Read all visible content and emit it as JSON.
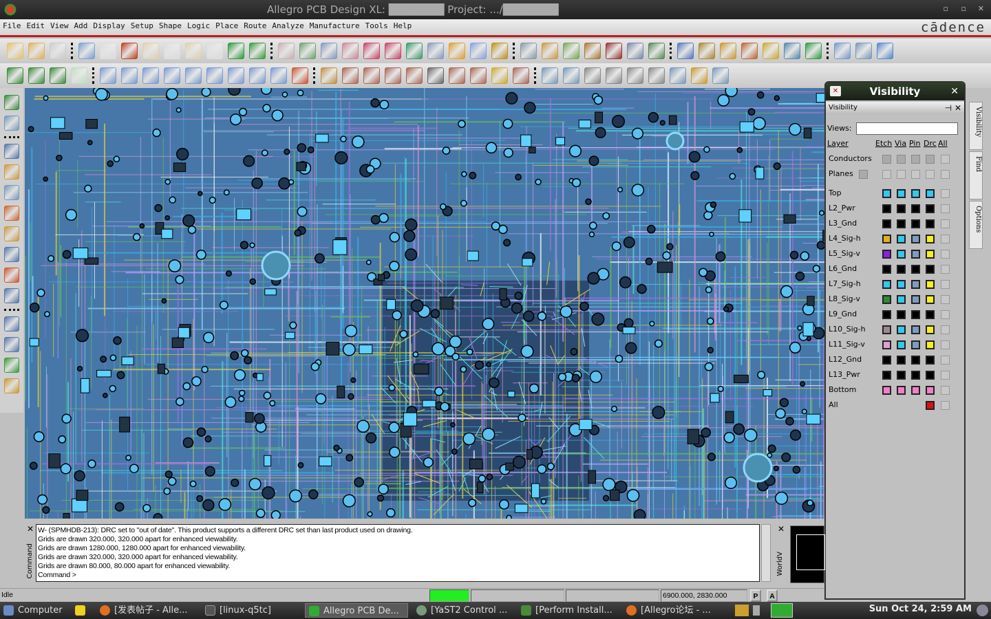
{
  "window": {
    "title": "Allegro PCB Design XL: ███████ Project: .../███████",
    "minimize": "▫",
    "maximize": "▫",
    "close": "✕"
  },
  "menu": {
    "items": [
      "File",
      "Edit",
      "View",
      "Add",
      "Display",
      "Setup",
      "Shape",
      "Logic",
      "Place",
      "Route",
      "Analyze",
      "Manufacture",
      "Tools",
      "Help"
    ],
    "brand": "cādence"
  },
  "toolbar1": [
    [
      "new-file-icon",
      "#e8c070"
    ],
    [
      "open-folder-icon",
      "#e0b060"
    ],
    [
      "save-icon",
      "#ccc"
    ],
    "|",
    [
      "move-icon",
      "#7aa0d0"
    ],
    [
      "copy-icon",
      "#ddd"
    ],
    [
      "delete-icon",
      "#c04020"
    ],
    [
      "undo-icon",
      "#e0d0b0"
    ],
    [
      "undo-list-icon",
      "#ddd"
    ],
    [
      "redo-icon",
      "#e0d0b0"
    ],
    [
      "redo-list-icon",
      "#ddd"
    ],
    [
      "done-icon",
      "#2a9a3a"
    ],
    [
      "pin-icon",
      "#3a9a3a"
    ],
    "|",
    [
      "grid-icon",
      "#c8b0b0"
    ],
    [
      "ratsnest-icon",
      "#70a070"
    ],
    [
      "zoom-fit-icon",
      "#8899bb"
    ],
    [
      "zoom-in-window-icon",
      "#cc8899"
    ],
    [
      "zoom-in-icon",
      "#cc4466"
    ],
    [
      "zoom-out-icon",
      "#cc4466"
    ],
    [
      "zoom-previous-icon",
      "#3a9a6a"
    ],
    [
      "zoom-world-icon",
      "#8899bb"
    ],
    [
      "redraw-icon",
      "#e0a030"
    ],
    [
      "3d-view-icon",
      "#8aa0dd"
    ],
    [
      "flip-icon",
      "#c09020"
    ],
    "|",
    [
      "grid-toggle-icon",
      "#8899aa"
    ],
    [
      "color-icon",
      "#cc9944"
    ],
    [
      "layers-icon",
      "#77aa55"
    ],
    [
      "shadow-icon",
      "#aa7733"
    ],
    [
      "stats-icon",
      "#993333"
    ],
    [
      "spreadsheet-icon",
      "#7788aa"
    ],
    [
      "board-icon",
      "#558855"
    ],
    "|",
    [
      "info-icon",
      "#5577bb"
    ],
    [
      "property-icon",
      "#aa8833"
    ],
    [
      "number-icon",
      "#cc9933"
    ],
    [
      "dehighlight-icon",
      "#bb6633"
    ],
    [
      "highlight-icon",
      "#ccaa33"
    ],
    [
      "bars-icon",
      "#5588aa"
    ],
    [
      "filter-icon",
      "#339944"
    ],
    "|",
    [
      "windows-icon",
      "#7799cc"
    ],
    [
      "mail-icon",
      "#7799bb"
    ],
    [
      "help-icon",
      "#5588cc"
    ]
  ],
  "toolbar2": [
    [
      "add-connect-icon",
      "#3a8a3a"
    ],
    [
      "slide-icon",
      "#3a8a3a"
    ],
    [
      "via-icon",
      "#3a8a3a"
    ],
    [
      "copper-icon",
      "#bde0bd"
    ],
    "|",
    [
      "shape-polygon-icon",
      "#7a9ad0"
    ],
    [
      "shape-rect-icon",
      "#7a9ad0"
    ],
    [
      "shape-circle-icon",
      "#7a9ad0"
    ],
    [
      "shape-select-icon",
      "#7a9ad0"
    ],
    [
      "shape-merge-icon",
      "#7a9ad0"
    ],
    [
      "shape-void-icon",
      "#7a9ad0"
    ],
    [
      "shape-void-rect-icon",
      "#7a9ad0"
    ],
    [
      "shape-void-circle-icon",
      "#7a9ad0"
    ],
    [
      "shape-edit-icon",
      "#7a9ad0"
    ],
    [
      "shape-delete-icon",
      "#cc5533"
    ],
    "|",
    [
      "dimension-icon",
      "#c09040"
    ],
    [
      "dim-linear-icon",
      "#aa6655"
    ],
    [
      "dim-length-icon",
      "#aa6655"
    ],
    [
      "dim-pin-icon",
      "#aa6655"
    ],
    [
      "dim-angle-icon",
      "#aa6655"
    ],
    [
      "line-icon",
      "#666"
    ],
    [
      "measure-icon",
      "#aa6655"
    ],
    [
      "cut-icon",
      "#aa6655"
    ],
    [
      "coin-icon",
      "#ccaa33"
    ],
    [
      "angle-icon",
      "#aa6655"
    ],
    "|",
    [
      "edit-text-icon",
      "#7799bb"
    ],
    [
      "mirror-icon",
      "#7799bb"
    ],
    [
      "rotate-icon",
      "#888"
    ],
    [
      "camera-icon",
      "#888"
    ],
    [
      "ref-des-icon",
      "#888"
    ],
    [
      "flag-icon",
      "#888"
    ],
    [
      "scan-icon",
      "#7799bb"
    ],
    [
      "key-icon",
      "#cc9933"
    ],
    [
      "network-icon",
      "#7799bb"
    ]
  ],
  "lefttoolbar": [
    [
      "place-manual-icon",
      "#3a8a3a"
    ],
    [
      "component-icon",
      "#7799bb"
    ],
    "|",
    [
      "route-icon",
      "#5577aa"
    ],
    [
      "slide-route-icon",
      "#cc9944"
    ],
    [
      "fanout-icon",
      "#7799bb"
    ],
    [
      "delay-tune-icon",
      "#cc6633"
    ],
    [
      "auto-route-icon",
      "#cc9944"
    ],
    [
      "spread-icon",
      "#5577aa"
    ],
    [
      "bus-icon",
      "#cc5533"
    ],
    [
      "pin-swap-icon",
      "#5577aa"
    ],
    "|",
    [
      "line-draw-icon",
      "#5577aa"
    ],
    [
      "rectangle-icon",
      "#5577aa"
    ],
    [
      "add-text-icon",
      "#3a9a3a"
    ],
    [
      "edit-text-icon",
      "#cc9933"
    ]
  ],
  "visibility": {
    "title": "Visibility",
    "panel_label": "Visibility",
    "views_label": "Views:",
    "views_value": "",
    "headers": {
      "layer": "Layer",
      "etch": "Etch",
      "via": "Via",
      "pin": "Pin",
      "drc": "Drc",
      "all": "All"
    },
    "groups": [
      {
        "name": "Conductors"
      },
      {
        "name": "Planes"
      }
    ],
    "layers": [
      {
        "name": "Top",
        "colors": [
          "#33c8ee",
          "#33c8ee",
          "#33c8ee",
          "#33c8ee"
        ]
      },
      {
        "name": "L2_Pwr",
        "colors": [
          "#000",
          "#000",
          "#000",
          "#000"
        ]
      },
      {
        "name": "L3_Gnd",
        "colors": [
          "#000",
          "#000",
          "#000",
          "#000"
        ]
      },
      {
        "name": "L4_Sig-h",
        "colors": [
          "#e0b020",
          "#33c8ee",
          "#7f9cc0",
          "#f5f020"
        ]
      },
      {
        "name": "L5_Sig-v",
        "colors": [
          "#8a20e0",
          "#33c8ee",
          "#7f9cc0",
          "#f5f020"
        ]
      },
      {
        "name": "L6_Gnd",
        "colors": [
          "#000",
          "#000",
          "#000",
          "#000"
        ]
      },
      {
        "name": "L7_Sig-h",
        "colors": [
          "#33c8ee",
          "#33c8ee",
          "#7f9cc0",
          "#f5f020"
        ]
      },
      {
        "name": "L8_Sig-v",
        "colors": [
          "#2e8b2e",
          "#33c8ee",
          "#7f9cc0",
          "#f5f020"
        ]
      },
      {
        "name": "L9_Gnd",
        "colors": [
          "#000",
          "#000",
          "#000",
          "#000"
        ]
      },
      {
        "name": "L10_Sig-h",
        "colors": [
          "#a08890",
          "#33c8ee",
          "#7f9cc0",
          "#f5f020"
        ]
      },
      {
        "name": "L11_Sig-v",
        "colors": [
          "#e0a0d0",
          "#33c8ee",
          "#7f9cc0",
          "#f5f020"
        ]
      },
      {
        "name": "L12_Gnd",
        "colors": [
          "#000",
          "#000",
          "#000",
          "#000"
        ]
      },
      {
        "name": "L13_Pwr",
        "colors": [
          "#000",
          "#000",
          "#000",
          "#000"
        ]
      },
      {
        "name": "Bottom",
        "colors": [
          "#f080c8",
          "#f080c8",
          "#f080c8",
          "#f080c8"
        ]
      },
      {
        "name": "All",
        "colors": [
          null,
          null,
          null,
          "#e01010"
        ]
      }
    ],
    "side_tabs": [
      "Visibility",
      "Find",
      "Options"
    ]
  },
  "console": {
    "label": "Command",
    "lines": [
      "W- (SPMHDB-213): DRC set to \"out of date\". This product supports a different DRC set than last product used on drawing.",
      "Grids are drawn 320.000, 320.000 apart for enhanced viewability.",
      "Grids are drawn 1280.000, 1280.000 apart for enhanced viewability.",
      "Grids are drawn 320.000, 320.000 apart for enhanced viewability.",
      "Grids are drawn 80.000, 80.000 apart for enhanced viewability.",
      "Command >"
    ]
  },
  "worldview": {
    "label": "WorldV"
  },
  "status": {
    "state": "Idle",
    "coords": "6900.000, 2830.000",
    "p_button": "P",
    "a_button": "A",
    "indicator_color": "#22ee22"
  },
  "taskbar": {
    "start": "Computer",
    "tasks": [
      "[发表帖子 - Alle...",
      "[linux-q5tc]",
      "Allegro PCB De...",
      "[YaST2 Control ...",
      "[Perform Install...",
      "[Allegro论坛 - ..."
    ],
    "clock": "Sun Oct 24,  2:59 AM"
  }
}
